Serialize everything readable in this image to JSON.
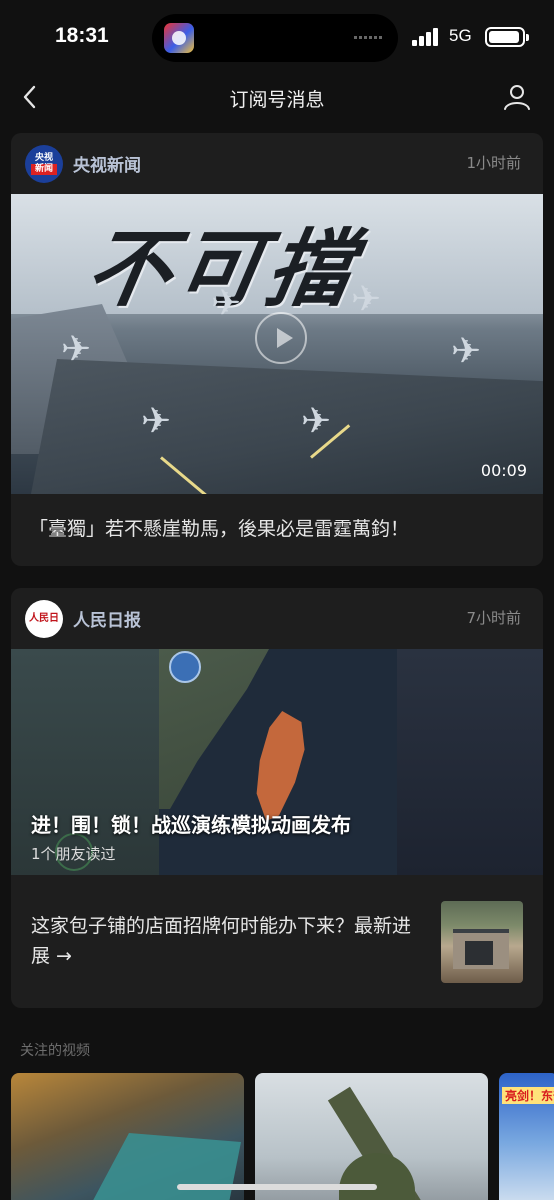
{
  "status_bar": {
    "time": "18:31",
    "network": "5G"
  },
  "nav": {
    "title": "订阅号消息"
  },
  "card1": {
    "source": "央视新闻",
    "logo_text_top": "央视",
    "logo_text_bottom": "新闻",
    "time": "1小时前",
    "video_overlay_text": "不可擋",
    "duration": "00:09",
    "caption": "「臺獨」若不懸崖勒馬，後果必是雷霆萬鈞！"
  },
  "card2": {
    "source": "人民日报",
    "logo_text": "人民日報",
    "time": "7小时前",
    "feature_title": "进！围！锁！战巡演练模拟动画发布",
    "feature_sub": "1个朋友读过",
    "news_title": "这家包子铺的店面招牌何时能办下来？最新进展 →"
  },
  "section": {
    "label": "关注的视频"
  },
  "video_tiles": [
    {
      "overlay": ""
    },
    {
      "overlay": ""
    },
    {
      "overlay": "亮剑！东部"
    }
  ],
  "colors": {
    "background": "#111111",
    "card": "#1e1e1e",
    "source_name": "#b9c3d6",
    "muted": "#8a8a8a"
  },
  "icons": [
    "back-chevron-icon",
    "user-profile-icon",
    "play-icon"
  ]
}
